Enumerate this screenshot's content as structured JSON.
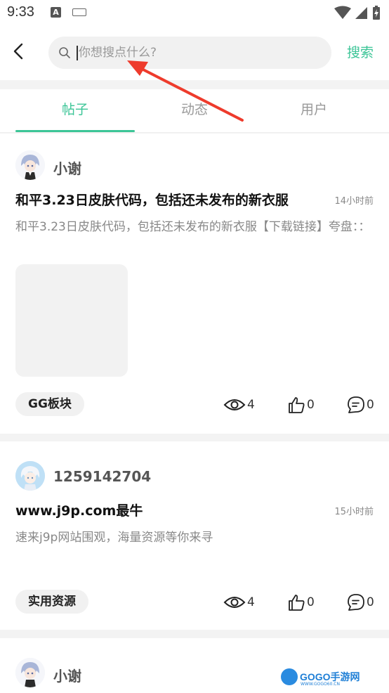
{
  "status_bar": {
    "time": "9:33",
    "icon_a": "A"
  },
  "header": {
    "search_placeholder": "你想搜点什么?",
    "search_button": "搜索"
  },
  "tabs": [
    {
      "label": "帖子",
      "active": true
    },
    {
      "label": "动态",
      "active": false
    },
    {
      "label": "用户",
      "active": false
    }
  ],
  "posts": [
    {
      "username": "小谢",
      "title": "和平3.23日皮肤代码，包括还未发布的新衣服",
      "time": "14小时前",
      "body": "和平3.23日皮肤代码，包括还未发布的新衣服【下载链接】夸盘：：",
      "tag": "GG板块",
      "views": "4",
      "likes": "0",
      "comments": "0"
    },
    {
      "username": "1259142704",
      "title": "www.j9p.com最牛",
      "time": "15小时前",
      "body": "速来j9p网站围观，海量资源等你来寻",
      "tag": "实用资源",
      "views": "4",
      "likes": "0",
      "comments": "0"
    },
    {
      "username": "小谢"
    }
  ],
  "watermark": {
    "brand": "GOGO手游网",
    "url": "WWW.GOGO60.CN"
  },
  "colors": {
    "accent": "#3cc597",
    "annotation_arrow": "#ee3b2c"
  }
}
